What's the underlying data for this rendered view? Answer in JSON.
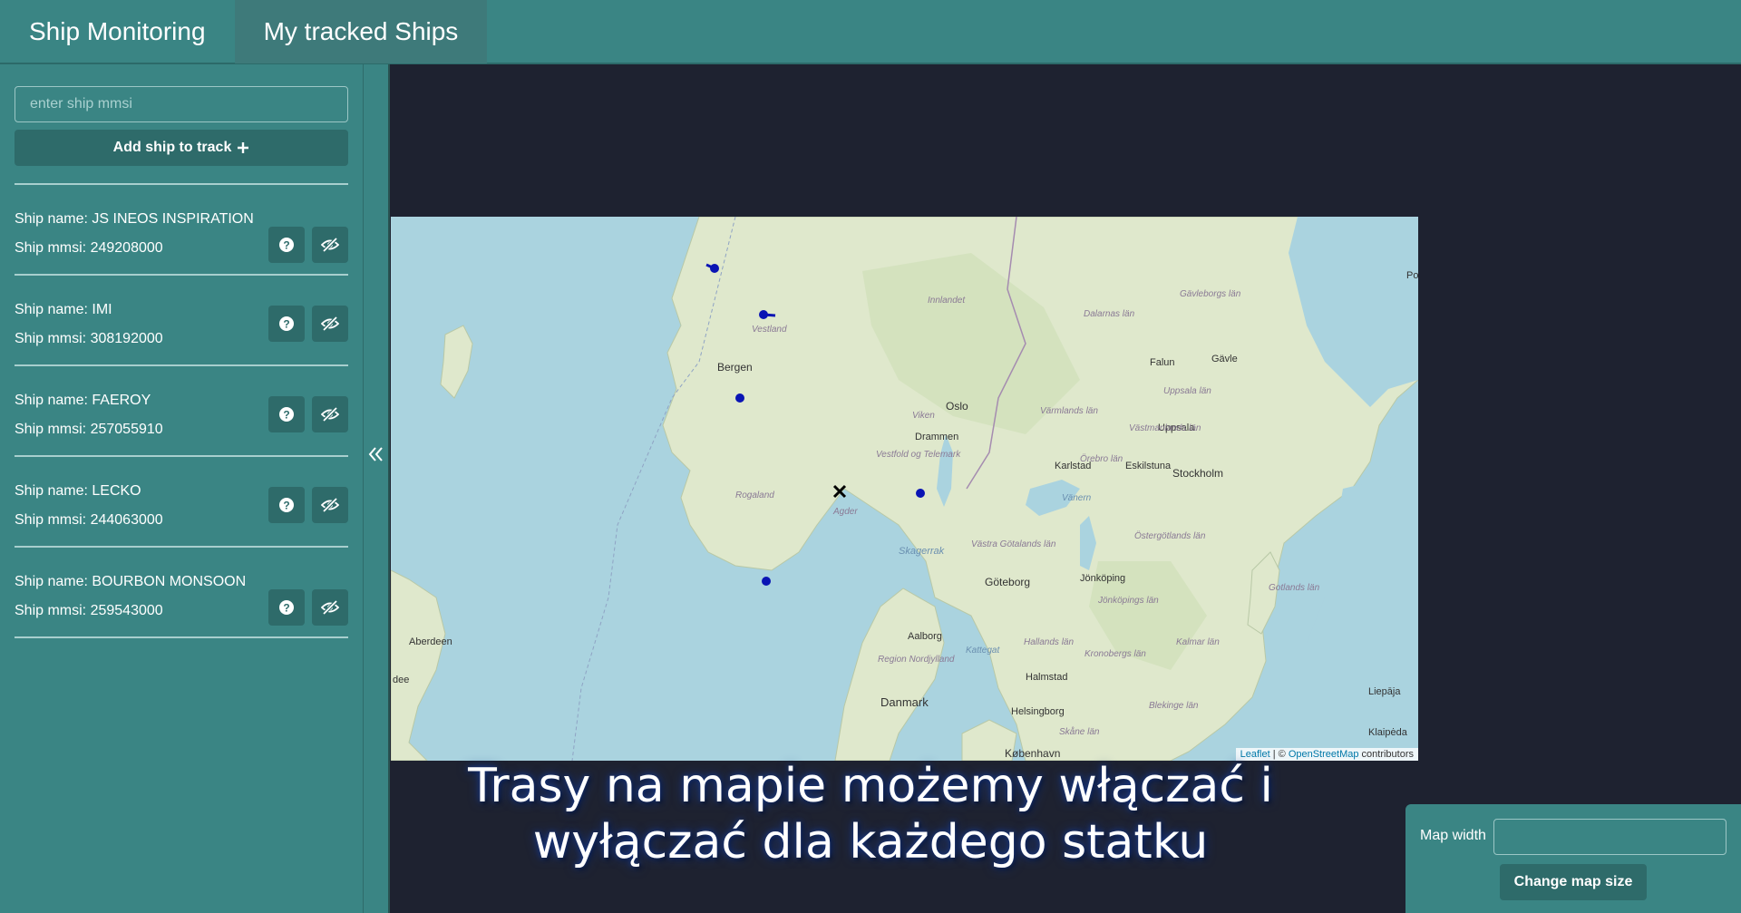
{
  "nav": {
    "tabs": [
      {
        "label": "Ship Monitoring"
      },
      {
        "label": "My tracked Ships"
      }
    ]
  },
  "sidebar": {
    "search_placeholder": "enter ship mmsi",
    "add_button_label": "Add ship to track",
    "add_button_icon": "plus-icon",
    "ships": [
      {
        "name_line": "Ship name: JS INEOS INSPIRATION",
        "mmsi_line": "Ship mmsi: 249208000"
      },
      {
        "name_line": "Ship name: IMI",
        "mmsi_line": "Ship mmsi: 308192000"
      },
      {
        "name_line": "Ship name: FAEROY",
        "mmsi_line": "Ship mmsi: 257055910"
      },
      {
        "name_line": "Ship name: LECKO",
        "mmsi_line": "Ship mmsi: 244063000"
      },
      {
        "name_line": "Ship name: BOURBON MONSOON",
        "mmsi_line": "Ship mmsi: 259543000"
      }
    ],
    "ship_button_icons": [
      "question-icon",
      "eye-slash-icon"
    ],
    "collapse_icon": "double-chevron-left-icon"
  },
  "map": {
    "labels": {
      "bergen": "Bergen",
      "vestland": "Vestland",
      "innlandet": "Innlandet",
      "oslo": "Oslo",
      "viken": "Viken",
      "drammen": "Drammen",
      "vestfold": "Vestfold og Telemark",
      "rogaland": "Rogaland",
      "agder": "Agder",
      "skagerrak": "Skagerrak",
      "goteborg": "Göteborg",
      "stockholm": "Stockholm",
      "uppsala": "Uppsala",
      "uppsala_lan": "Uppsala län",
      "gavle": "Gävle",
      "gavleborg": "Gävleborgs län",
      "dalarna": "Dalarnas län",
      "falun": "Falun",
      "varmland": "Värmlands län",
      "karlstad": "Karlstad",
      "vastmanland": "Västmanlands län",
      "orebro": "Örebro län",
      "eskilstuna": "Eskilstuna",
      "vanern": "Vänern",
      "vastra": "Västra Götalands län",
      "ostergotland": "Östergötlands län",
      "jonkoping": "Jönköping",
      "jonkopings_lan": "Jönköpings län",
      "kalmar": "Kalmar län",
      "gotland": "Gotlands län",
      "hallands": "Hallands län",
      "kronoberg": "Kronobergs län",
      "blekinge": "Blekinge län",
      "halmstad": "Halmstad",
      "helsingborg": "Helsingborg",
      "skane": "Skåne län",
      "kobenhavn": "København",
      "danmark": "Danmark",
      "aalborg": "Aalborg",
      "region_nord": "Region Nordjylland",
      "kattegat": "Kattegat",
      "aberdeen": "Aberdeen",
      "dee": "dee",
      "liepaja": "Liepāja",
      "klaipeda": "Klaipėda",
      "po": "Po"
    },
    "attribution": {
      "leaflet": "Leaflet",
      "sep": " | © ",
      "osm": "OpenStreetMap",
      "contrib": " contributors"
    }
  },
  "subtitle": {
    "line1": "Trasy na mapie możemy włączać i",
    "line2": "wyłączać dla każdego statku"
  },
  "panel": {
    "map_width_label": "Map width",
    "map_width_value": "",
    "change_button_label": "Change map size"
  },
  "colors": {
    "primary": "#3a8584",
    "primary_dark": "#2e6b6a",
    "background": "#1e2230",
    "sea": "#aad3df",
    "land": "#e6ebd9",
    "ship_marker": "#0a14b4"
  }
}
